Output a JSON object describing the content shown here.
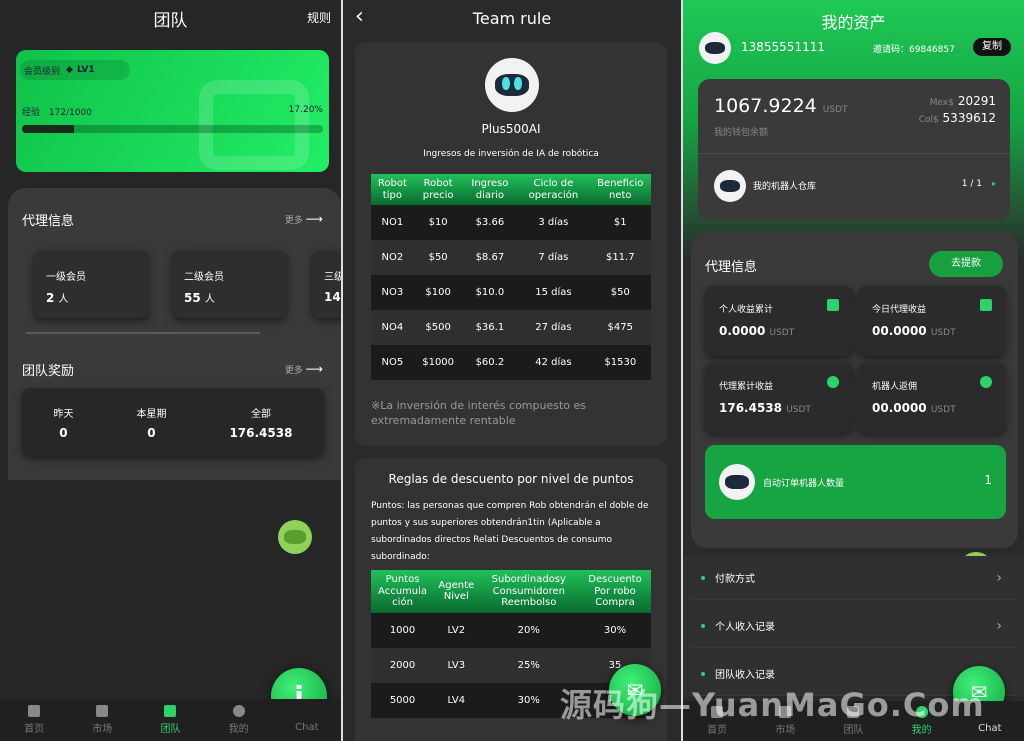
{
  "team": {
    "title": "团队",
    "rules_link": "规则",
    "level_label": "会员级别",
    "level_value": "LV1",
    "exp_label": "经验",
    "exp_value": "172/1000",
    "exp_percent_label": "17.20%",
    "exp_progress": 0.172,
    "agent_title": "代理信息",
    "agent_more": "更多",
    "members": [
      {
        "label": "一级会员",
        "count": "2",
        "unit": "人"
      },
      {
        "label": "二级会员",
        "count": "55",
        "unit": "人"
      },
      {
        "label": "三级",
        "count": "14",
        "unit": ""
      }
    ],
    "reward_title": "团队奖励",
    "reward_more": "更多",
    "rewards": [
      {
        "label": "昨天",
        "value": "0"
      },
      {
        "label": "本星期",
        "value": "0"
      },
      {
        "label": "全部",
        "value": "176.4538"
      }
    ],
    "fab_label": "j"
  },
  "nav1": [
    {
      "label": "首页"
    },
    {
      "label": "市场"
    },
    {
      "label": "团队"
    },
    {
      "label": "我的"
    },
    {
      "label": "Chat"
    }
  ],
  "rule": {
    "title": "Team rule",
    "back": "‹",
    "brand": "Plus500AI",
    "subtitle": "Ingresos de inversión de IA de robótica",
    "headers": [
      "Robot tipo",
      "Robot precio",
      "Ingreso diario",
      "Ciclo de operación",
      "Beneficio neto"
    ],
    "rows": [
      [
        "NO1",
        "$10",
        "$3.66",
        "3 días",
        "$1"
      ],
      [
        "NO2",
        "$50",
        "$8.67",
        "7 días",
        "$11.7"
      ],
      [
        "NO3",
        "$100",
        "$10.0",
        "15 días",
        "$50"
      ],
      [
        "NO4",
        "$500",
        "$36.1",
        "27 días",
        "$475"
      ],
      [
        "NO5",
        "$1000",
        "$60.2",
        "42 días",
        "$1530"
      ]
    ],
    "note": "※La inversión de interés compuesto es extremadamente rentable",
    "discount_title": "Reglas de descuento por nivel de puntos",
    "discount_text": "Puntos: las personas que compren Rob obtendrán el doble de puntos y sus superiores obtendrán1tin (Aplicable a subordinados directos Relati Descuentos de consumo subordinado:",
    "headers2": [
      "Puntos Accumula ción",
      "Agente Nivel",
      "Subordinadosy Consumidoren Reembolso",
      "Descuento Por robo Compra"
    ],
    "rows2": [
      [
        "1000",
        "LV2",
        "20%",
        "30%"
      ],
      [
        "2000",
        "LV3",
        "25%",
        "35"
      ],
      [
        "5000",
        "LV4",
        "30%",
        "40"
      ]
    ]
  },
  "assets": {
    "title": "我的资产",
    "phone": "13855551111",
    "invite_label": "邀请码：",
    "invite_code": "69846857",
    "copy": "复制",
    "balance": "1067.9224",
    "balance_unit": "USDT",
    "balance_label": "我的钱包余额",
    "mex_label": "Mex$",
    "mex_value": "20291",
    "col_label": "Col$",
    "col_value": "5339612",
    "warehouse_label": "我的机器人仓库",
    "warehouse_count": "1 / 1",
    "agent_title": "代理信息",
    "withdraw": "去提款",
    "stats": [
      {
        "label": "个人收益累计",
        "value": "0.0000",
        "unit": "USDT"
      },
      {
        "label": "今日代理收益",
        "value": "00.0000",
        "unit": "USDT"
      },
      {
        "label": "代理累计收益",
        "value": "176.4538",
        "unit": "USDT"
      },
      {
        "label": "机器人返佣",
        "value": "00.0000",
        "unit": "USDT"
      }
    ],
    "auto_label": "自动订单机器人数量",
    "auto_count": "1",
    "menu": [
      {
        "label": "付款方式"
      },
      {
        "label": "个人收入记录"
      },
      {
        "label": "团队收入记录"
      }
    ]
  },
  "nav3": [
    {
      "label": "首页"
    },
    {
      "label": "市场"
    },
    {
      "label": "团队"
    },
    {
      "label": "我的"
    },
    {
      "label": "Chat"
    }
  ],
  "watermark": "源码狗—YuanMaGo.Com",
  "colors": {
    "accent": "#1fd35e",
    "dark": "#262626"
  }
}
